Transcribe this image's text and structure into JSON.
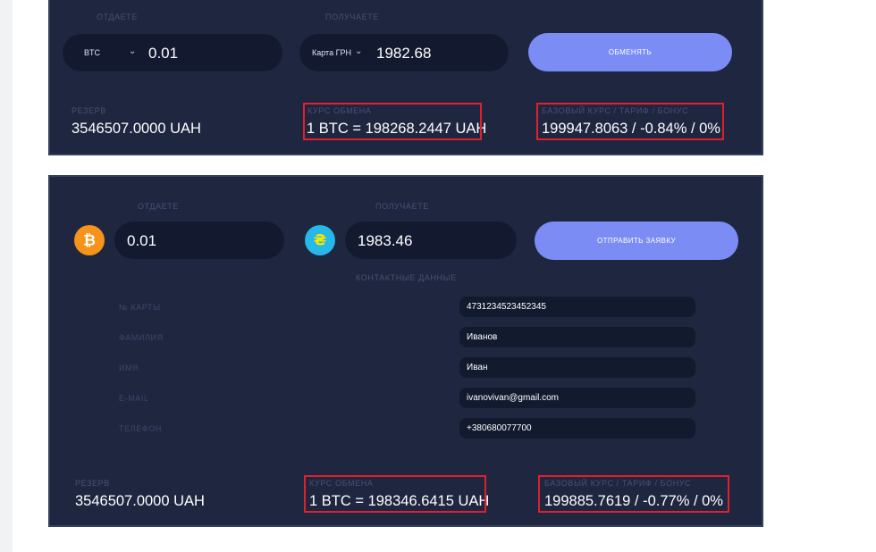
{
  "widget1": {
    "give_label": "ОТДАЕТЕ",
    "get_label": "ПОЛУЧАЕТЕ",
    "give_currency": "BTC",
    "give_amount": "0.01",
    "get_currency": "Карта ГРН",
    "get_amount": "1982.68",
    "exchange_button": "ОБМЕНЯТЬ",
    "reserve_label": "РЕЗЕРВ",
    "reserve_value": "3546507.0000 UAH",
    "rate_label": "КУРС ОБМЕНА",
    "rate_value": "1 BTC = 198268.2447 UAH",
    "base_label": "БАЗОВЫЙ КУРС / ТАРИФ / БОНУС",
    "base_value": "199947.8063 / -0.84% / 0%"
  },
  "widget2": {
    "give_label": "ОТДАЕТЕ",
    "get_label": "ПОЛУЧАЕТЕ",
    "give_amount": "0.01",
    "get_amount": "1983.46",
    "submit_button": "ОТПРАВИТЬ ЗАЯВКУ",
    "contacts_label": "КОНТАКТНЫЕ ДАННЫЕ",
    "fields": [
      {
        "label": "№ КАРТЫ",
        "value": "4731234523452345"
      },
      {
        "label": "ФАМИЛИЯ",
        "value": "Иванов"
      },
      {
        "label": "ИМЯ",
        "value": "Иван"
      },
      {
        "label": "E-MAIL",
        "value": "ivanovivan@gmail.com"
      },
      {
        "label": "ТЕЛЕФОН",
        "value": "+380680077700"
      }
    ],
    "reserve_label": "РЕЗЕРВ",
    "reserve_value": "3546507.0000 UAH",
    "rate_label": "КУРС ОБМЕНА",
    "rate_value": "1 BTC = 198346.6415 UAH",
    "base_label": "БАЗОВЫЙ КУРС / ТАРИФ / БОНУС",
    "base_value": "199885.7619 / -0.77% / 0%"
  },
  "icons": {
    "chevron": "chevron-down-icon",
    "btc_coin": "bitcoin-coin-icon",
    "uah_coin": "hryvnia-coin-icon"
  },
  "colors": {
    "panel_bg": "#1f2640",
    "input_bg": "#131a30",
    "button": "#7c8cf5",
    "highlight": "#e0202c",
    "btc": "#f7931a",
    "uah": "#26b8e6"
  }
}
